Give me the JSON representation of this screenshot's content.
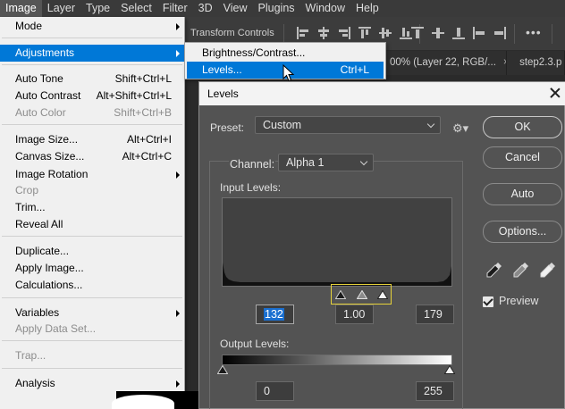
{
  "menubar": {
    "items": [
      "Image",
      "Layer",
      "Type",
      "Select",
      "Filter",
      "3D",
      "View",
      "Plugins",
      "Window",
      "Help"
    ]
  },
  "options_bar": {
    "transform_label": "Transform Controls",
    "more_label": "•••"
  },
  "doc_tabs": [
    {
      "label": "00% (Layer 22, RGB/...",
      "close": "×"
    },
    {
      "label": "step2.3.p",
      "close": ""
    }
  ],
  "image_menu": {
    "items": [
      {
        "label": "Mode",
        "shortcut": "",
        "submenu": true,
        "disabled": false
      },
      {
        "label": "Adjustments",
        "shortcut": "",
        "submenu": true,
        "disabled": false,
        "highlighted": true
      },
      {
        "label": "Auto Tone",
        "shortcut": "Shift+Ctrl+L",
        "disabled": false
      },
      {
        "label": "Auto Contrast",
        "shortcut": "Alt+Shift+Ctrl+L",
        "disabled": false
      },
      {
        "label": "Auto Color",
        "shortcut": "Shift+Ctrl+B",
        "disabled": true
      },
      {
        "label": "Image Size...",
        "shortcut": "Alt+Ctrl+I",
        "disabled": false
      },
      {
        "label": "Canvas Size...",
        "shortcut": "Alt+Ctrl+C",
        "disabled": false
      },
      {
        "label": "Image Rotation",
        "shortcut": "",
        "submenu": true,
        "disabled": false
      },
      {
        "label": "Crop",
        "shortcut": "",
        "disabled": true
      },
      {
        "label": "Trim...",
        "shortcut": "",
        "disabled": false
      },
      {
        "label": "Reveal All",
        "shortcut": "",
        "disabled": false
      },
      {
        "label": "Duplicate...",
        "shortcut": "",
        "disabled": false
      },
      {
        "label": "Apply Image...",
        "shortcut": "",
        "disabled": false
      },
      {
        "label": "Calculations...",
        "shortcut": "",
        "disabled": false
      },
      {
        "label": "Variables",
        "shortcut": "",
        "submenu": true,
        "disabled": false
      },
      {
        "label": "Apply Data Set...",
        "shortcut": "",
        "disabled": true
      },
      {
        "label": "Trap...",
        "shortcut": "",
        "disabled": true
      },
      {
        "label": "Analysis",
        "shortcut": "",
        "submenu": true,
        "disabled": false
      }
    ]
  },
  "adjust_submenu": {
    "items": [
      {
        "label": "Brightness/Contrast...",
        "shortcut": ""
      },
      {
        "label": "Levels...",
        "shortcut": "Ctrl+L",
        "highlighted": true
      }
    ]
  },
  "levels_dialog": {
    "title": "Levels",
    "preset_label": "Preset:",
    "preset_value": "Custom",
    "channel_label": "Channel:",
    "channel_value": "Alpha 1",
    "input_levels_label": "Input Levels:",
    "input_black": "132",
    "input_gamma": "1.00",
    "input_white": "179",
    "output_levels_label": "Output Levels:",
    "output_black": "0",
    "output_white": "255",
    "buttons": {
      "ok": "OK",
      "cancel": "Cancel",
      "auto": "Auto",
      "options": "Options..."
    },
    "preview_label": "Preview",
    "preview_checked": true
  },
  "colors": {
    "highlight": "#0078d7",
    "dialog_bg": "#535353",
    "slider_outline": "#e6d23a"
  }
}
